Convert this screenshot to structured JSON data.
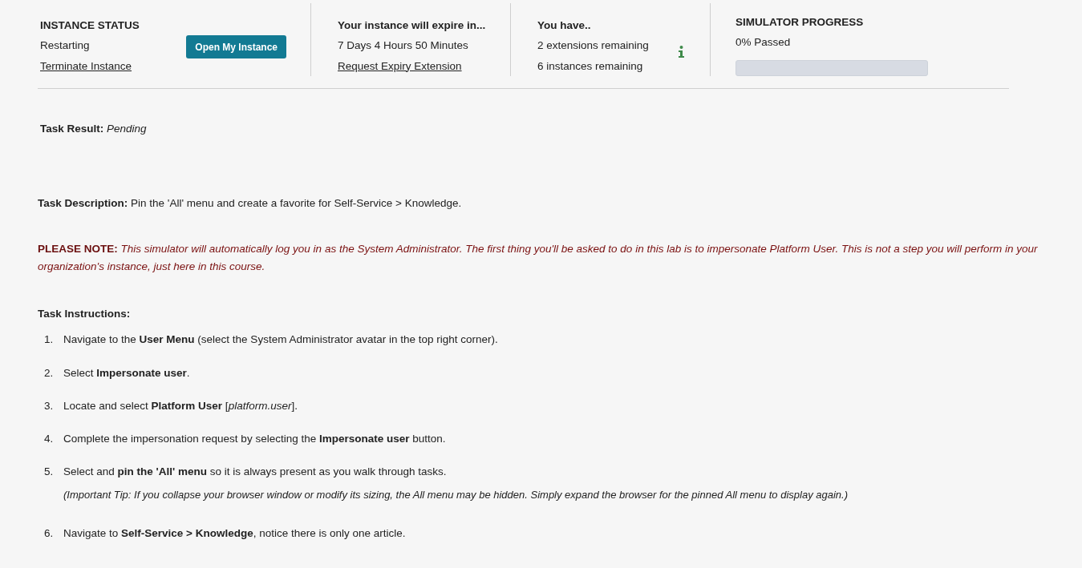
{
  "instance_status": {
    "heading": "INSTANCE STATUS",
    "status": "Restarting",
    "terminate_link": "Terminate Instance",
    "open_button": "Open My Instance"
  },
  "expiry": {
    "heading": "Your instance will expire in...",
    "remaining": "7 Days 4 Hours 50 Minutes",
    "extension_link": "Request Expiry Extension"
  },
  "allowance": {
    "heading": "You have..",
    "extensions": "2 extensions remaining",
    "instances": "6 instances remaining"
  },
  "progress": {
    "heading": "SIMULATOR PROGRESS",
    "reading": "0% Passed",
    "level": 0
  },
  "task_result": "**Task Result:** *Pending*",
  "task_description": "**Task Description:** Pin the 'All' menu and create a favorite for Self-Service > Knowledge.",
  "note": "**PLEASE NOTE:** *This simulator will automatically log you in as the System Administrator. The first thing you'll be asked to do in this lab is to impersonate Platform User. This is not a step you will perform in your organization's instance, just here in this course.*",
  "instructions_heading": "Task Instructions:",
  "steps": [
    {
      "number": "1.",
      "text": "Navigate to the **User Menu** (select the System Administrator avatar in the top right corner)."
    },
    {
      "number": "2.",
      "text": "Select **Impersonate user**."
    },
    {
      "number": "3.",
      "text": "Locate and select **Platform User** [*platform.user*]."
    },
    {
      "number": "4.",
      "text": "Complete the impersonation request by selecting the **Impersonate user** button."
    },
    {
      "number": "5.",
      "text": "Select and **pin the 'All' menu** so it is always present as you walk through tasks.",
      "tip": "(Important Tip:  If you collapse your browser window or modify its sizing, the All menu may be hidden. Simply expand the browser for the pinned All menu to display again.)"
    },
    {
      "number": "6.",
      "text": "Navigate to **Self-Service > Knowledge**, notice there is only one article."
    }
  ]
}
